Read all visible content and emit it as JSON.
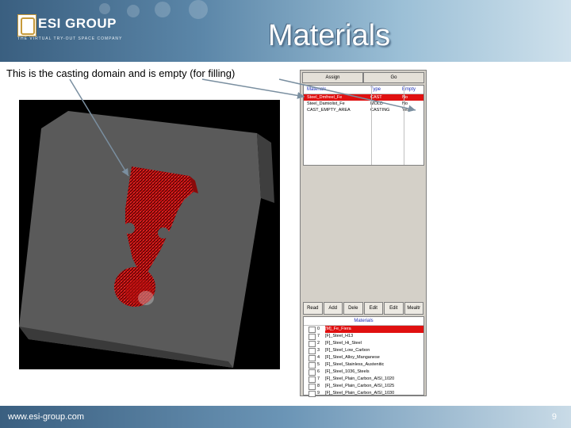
{
  "header": {
    "logo_text": "ESI GROUP",
    "logo_tagline": "THE VIRTUAL TRY-OUT SPACE COMPANY",
    "title": "Materials"
  },
  "caption": "This is the casting domain and is empty (for filling)",
  "panel": {
    "tabs": [
      "Assign",
      "Go"
    ],
    "materials_table": {
      "headers": [
        "Materials",
        "Type",
        "Empty"
      ],
      "rows": [
        {
          "name": "Steel_Dmfreel_Fe",
          "type": "CAST",
          "empty": "No"
        },
        {
          "name": "Steel_Damiolist_Fe",
          "type": "MOLD",
          "empty": "No"
        },
        {
          "name": "CAST_EMPTY_AREA",
          "type": "CASTING",
          "empty": "Yes"
        }
      ]
    },
    "buttons": [
      "Read",
      "Add",
      "Dele",
      "Edit",
      "Edit",
      "Mealtr"
    ],
    "library": {
      "header": "Materials",
      "rows": [
        {
          "num": "0",
          "name": "[M]_Fe_Fiera"
        },
        {
          "num": "7",
          "name": "[F]_Steel_H13"
        },
        {
          "num": "2",
          "name": "[F]_Steel_Hi_Steel"
        },
        {
          "num": "3",
          "name": "[F]_Steel_Low_Carbon"
        },
        {
          "num": "4",
          "name": "[F]_Steel_Alloy_Manganese"
        },
        {
          "num": "5",
          "name": "[F]_Steel_Stainless_Austenitic"
        },
        {
          "num": "6",
          "name": "[F]_Steel_1036_Steels"
        },
        {
          "num": "7",
          "name": "[F]_Steel_Plain_Carbon_AISI_1020"
        },
        {
          "num": "8",
          "name": "[F]_Steel_Plain_Carbon_AISI_1025"
        },
        {
          "num": "9",
          "name": "[F]_Steel_Plain_Carbon_AISI_1030"
        }
      ]
    }
  },
  "footer": {
    "url": "www.esi-group.com",
    "page": "9"
  },
  "colors": {
    "header_blue": "#3a5f80",
    "casting_red": "#e01010",
    "mold_gray": "#555555",
    "selection_red": "#e01010",
    "table_header_blue": "#1a2eb8"
  }
}
